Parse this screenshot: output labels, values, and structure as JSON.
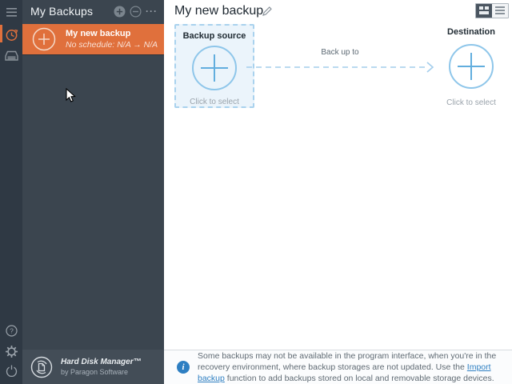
{
  "colors": {
    "accent_orange": "#e0703c",
    "rail_bg": "#2f3944",
    "sidebar_bg": "#3b454f",
    "footer_bg": "#434d57",
    "link_blue": "#2e7fc2",
    "circle_blue": "#8ec6ea",
    "box_bg": "#ebf4fb"
  },
  "rail": {
    "menu": "hamburger-menu",
    "sections": [
      {
        "name": "backup-jobs",
        "icon": "clock-icon",
        "active": true
      },
      {
        "name": "disk-manager",
        "icon": "drive-icon",
        "active": false
      }
    ],
    "bottom": [
      {
        "name": "help",
        "icon": "question-icon"
      },
      {
        "name": "settings",
        "icon": "gear-icon"
      },
      {
        "name": "power",
        "icon": "power-icon"
      }
    ]
  },
  "sidebar": {
    "title": "My Backups",
    "actions": {
      "add": "add-backup",
      "remove": "remove-backup",
      "more": "more-options",
      "more_glyph": "···"
    },
    "selected_backup": {
      "title": "My new backup",
      "subtitle": "No schedule: N/A → N/A"
    },
    "footer": {
      "product": "Hard Disk Manager™",
      "vendor": "by Paragon Software"
    }
  },
  "main": {
    "title": "My new backup",
    "view_toggle": {
      "tiles_active": true
    },
    "source": {
      "title": "Backup source",
      "hint": "Click to select"
    },
    "destination": {
      "title": "Destination",
      "hint": "Click to select"
    },
    "arrow_label": "Back up to"
  },
  "infobar": {
    "text_before": "Some backups may not be available in the program interface, when you're in the recovery environment, where backup storages are not updated. Use the ",
    "link": "Import backup",
    "text_after": " function to add backups stored on local and removable storage devices."
  }
}
